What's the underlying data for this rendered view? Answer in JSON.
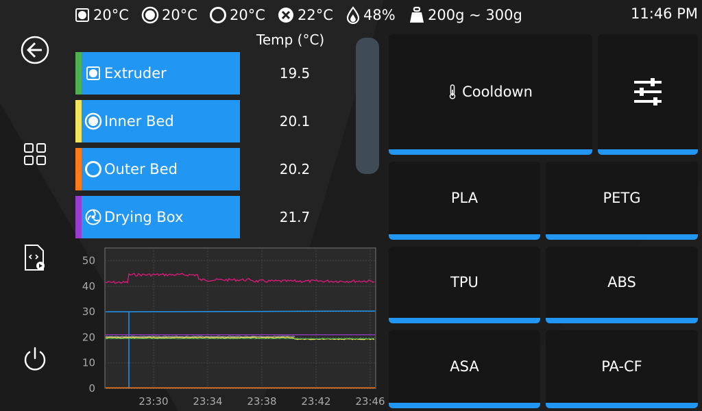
{
  "status": {
    "extruder_temp": "20°C",
    "inner_bed_temp": "20°C",
    "outer_bed_temp": "20°C",
    "drying_box_temp": "22°C",
    "humidity": "48%",
    "filament_weight": "200g ~ 300g",
    "time": "11:46 PM"
  },
  "nav": {
    "icons": [
      "back-arrow-icon",
      "grid-icon",
      "gcode-file-icon",
      "power-icon"
    ]
  },
  "temp_table": {
    "header": "Temp (°C)",
    "sensors": [
      {
        "label": "Extruder",
        "value": "19.5",
        "color": "#4caf50",
        "icon": "extruder-icon"
      },
      {
        "label": "Inner Bed",
        "value": "20.1",
        "color": "#f3e45c",
        "icon": "inner-bed-icon"
      },
      {
        "label": "Outer Bed",
        "value": "20.2",
        "color": "#ff7a1a",
        "icon": "outer-bed-icon"
      },
      {
        "label": "Drying Box",
        "value": "21.7",
        "color": "#9c3bd1",
        "icon": "drying-box-icon"
      }
    ]
  },
  "graph": {
    "y_ticks": [
      "50",
      "40",
      "30",
      "20",
      "10",
      "0"
    ],
    "x_ticks": [
      "23:30",
      "23:34",
      "23:38",
      "23:42",
      "23:46"
    ],
    "ylim": [
      0,
      55
    ]
  },
  "presets": {
    "cooldown": "Cooldown",
    "settings_icon": "sliders-icon",
    "materials": [
      "PLA",
      "PETG",
      "TPU",
      "ABS",
      "ASA",
      "PA-CF"
    ]
  },
  "colors": {
    "accent": "#2196f3",
    "background": "#1f1f1f",
    "button": "#161616"
  }
}
